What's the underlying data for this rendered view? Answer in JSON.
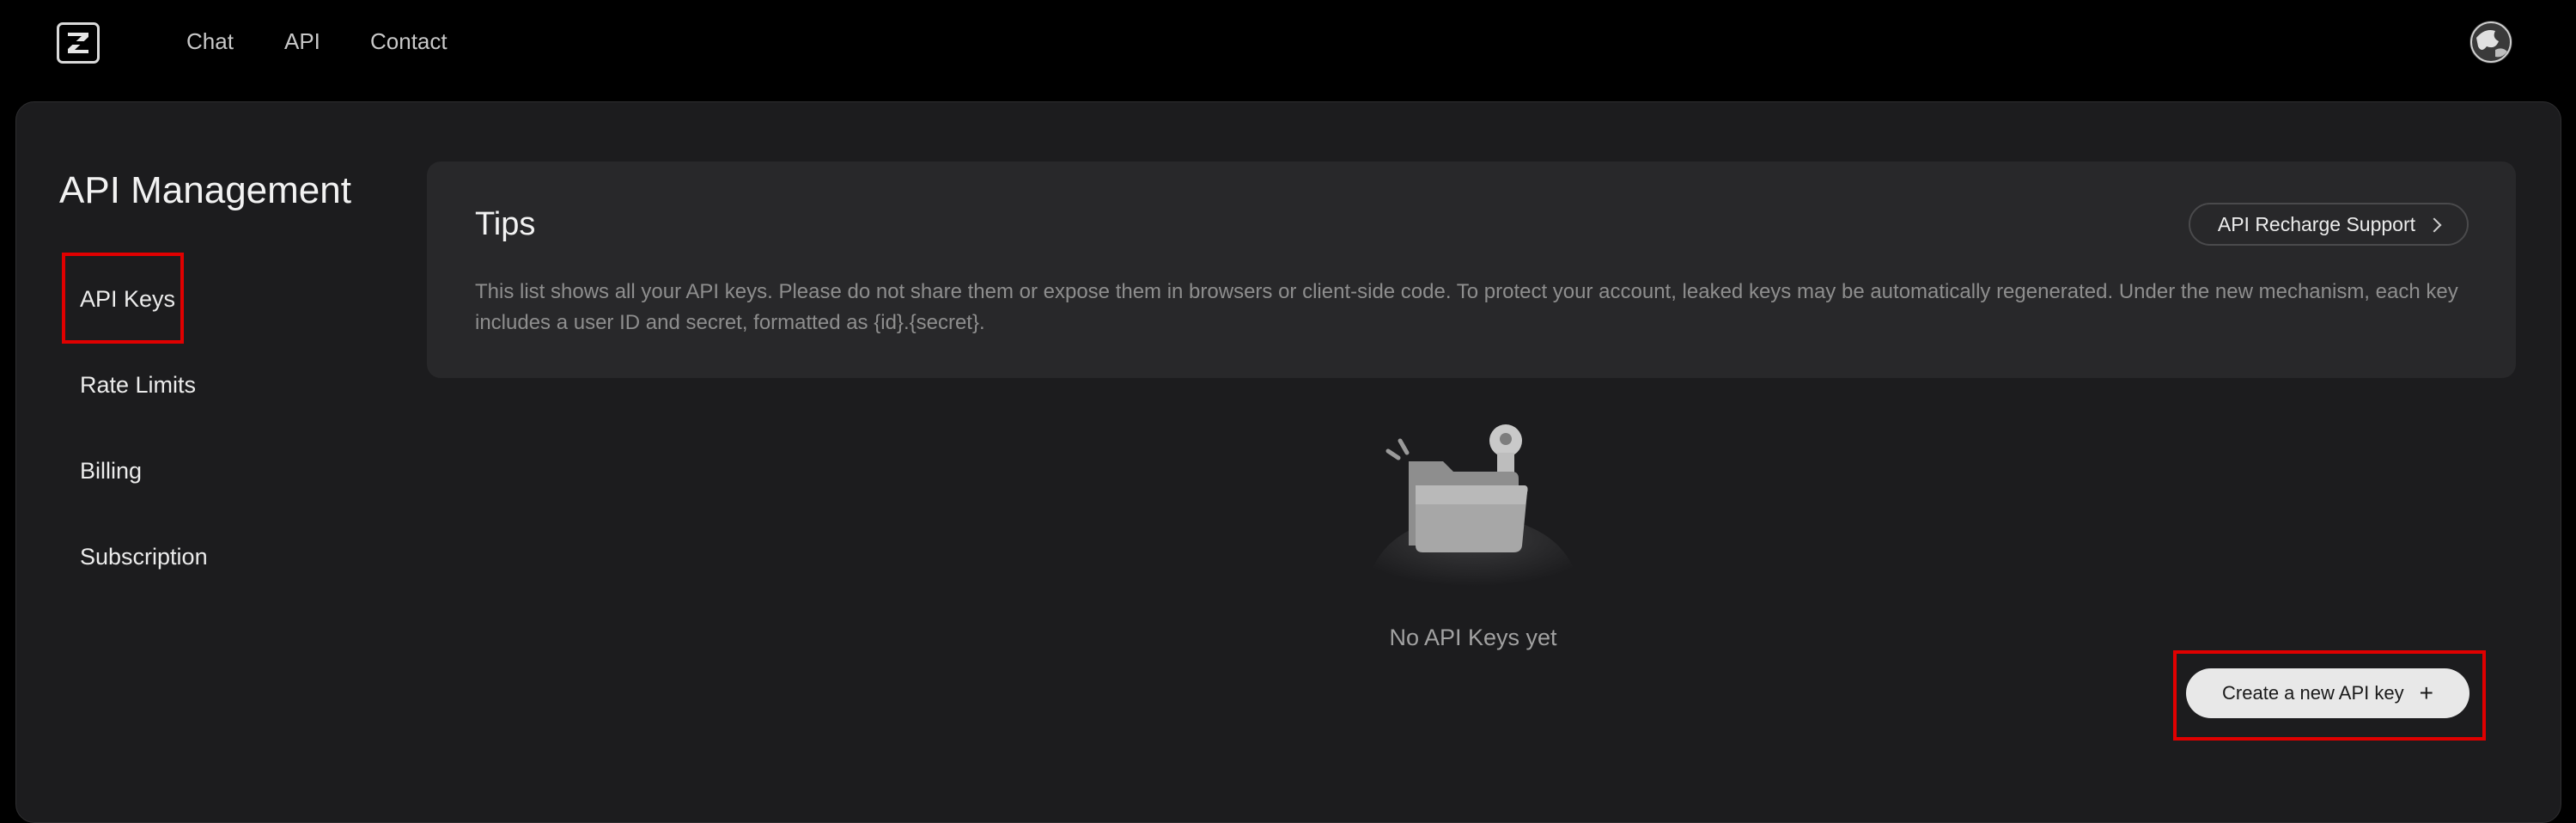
{
  "nav": {
    "logo_letter": "Z",
    "links": [
      "Chat",
      "API",
      "Contact"
    ]
  },
  "sidebar": {
    "title": "API Management",
    "items": [
      {
        "label": "API Keys",
        "selected": true
      },
      {
        "label": "Rate Limits",
        "selected": false
      },
      {
        "label": "Billing",
        "selected": false
      },
      {
        "label": "Subscription",
        "selected": false
      }
    ]
  },
  "tips": {
    "title": "Tips",
    "text": "This list shows all your API keys. Please do not share them or expose them in browsers or client-side code. To protect your account, leaked keys may be automatically regenerated. Under the new mechanism, each key includes a user ID and secret, formatted as {id}.{secret}.",
    "recharge_button": "API Recharge Support"
  },
  "empty_state": {
    "text": "No API Keys yet",
    "icon": "folder-key-icon"
  },
  "create_button": {
    "label": "Create a new API key",
    "icon": "plus-icon"
  },
  "colors": {
    "page_bg": "#000000",
    "panel_bg": "#1c1c1e",
    "card_bg": "#28282a",
    "highlight": "#e00000",
    "button_bg": "#e8e8e8"
  }
}
